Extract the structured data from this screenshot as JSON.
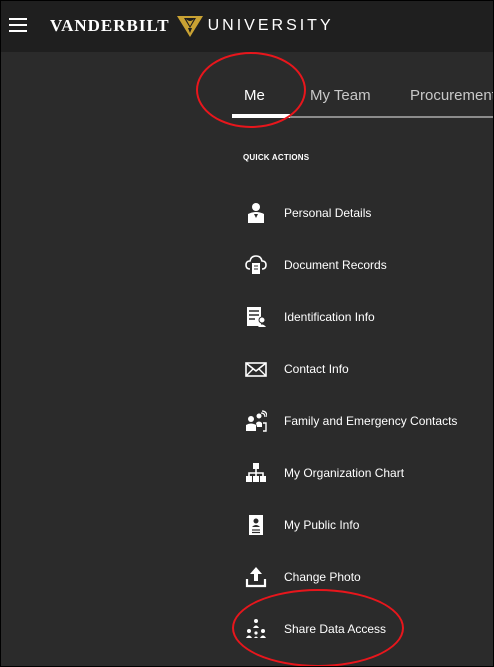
{
  "header": {
    "brand_left": "VANDERBILT",
    "brand_right": "UNIVERSITY",
    "logo": "vanderbilt-v-oak-leaf-logo",
    "menu_icon": "hamburger-icon",
    "background": "#1f1f1f"
  },
  "tabs": [
    {
      "label": "Me",
      "active": true
    },
    {
      "label": "My Team",
      "active": false
    },
    {
      "label": "Procurement",
      "active": false
    }
  ],
  "quick_actions": {
    "heading": "QUICK ACTIONS",
    "items": [
      {
        "label": "Personal Details",
        "icon": "person-icon"
      },
      {
        "label": "Document Records",
        "icon": "cloud-document-icon"
      },
      {
        "label": "Identification Info",
        "icon": "id-document-icon"
      },
      {
        "label": "Contact Info",
        "icon": "envelope-icon"
      },
      {
        "label": "Family and Emergency Contacts",
        "icon": "family-contacts-icon"
      },
      {
        "label": "My Organization Chart",
        "icon": "org-chart-icon"
      },
      {
        "label": "My Public Info",
        "icon": "public-profile-icon"
      },
      {
        "label": "Change Photo",
        "icon": "upload-icon"
      },
      {
        "label": "Share Data Access",
        "icon": "share-people-icon"
      }
    ]
  },
  "colors": {
    "background": "#2b2b2b",
    "text": "#ffffff",
    "tab_underline": "#ffffff",
    "logo_gold": "#c9a233",
    "annotation_red": "#e8161c"
  }
}
